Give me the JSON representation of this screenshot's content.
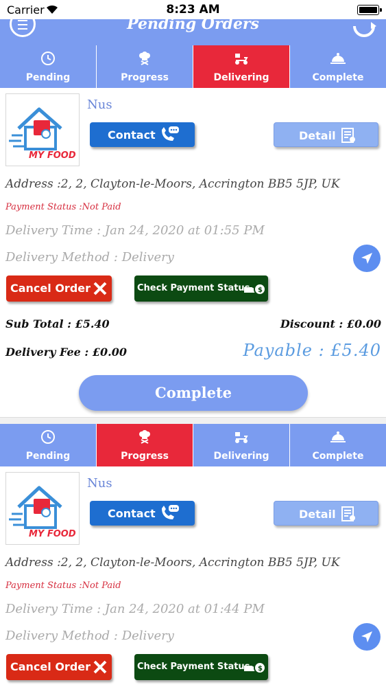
{
  "status_bar": {
    "carrier": "Carrier",
    "time": "8:23 AM"
  },
  "nav": {
    "title": "Pending Orders"
  },
  "tabs": [
    {
      "label": "Pending"
    },
    {
      "label": "Progress"
    },
    {
      "label": "Delivering"
    },
    {
      "label": "Complete"
    }
  ],
  "colors": {
    "accent": "#7b9cf0",
    "active_tab": "#e8283a",
    "contact": "#1e6ed0",
    "cancel": "#d92a16",
    "check_payment": "#0c4a12",
    "payable": "#5a9be0"
  },
  "orders": [
    {
      "active_tab": 2,
      "logo_text": "MY FOOD",
      "customer": "Nus",
      "contact_label": "Contact",
      "detail_label": "Detail",
      "address": "Address :2, 2, Clayton-le-Moors, Accrington BB5 5JP, UK",
      "payment_status": "Payment Status :Not Paid",
      "delivery_time": "Delivery Time : Jan 24, 2020 at 01:55 PM",
      "delivery_method": "Delivery Method : Delivery",
      "cancel_label": "Cancel Order",
      "check_label": "Check Payment Status",
      "subtotal": "Sub Total : £5.40",
      "discount": "Discount : £0.00",
      "delivery_fee": "Delivery Fee : £0.00",
      "payable": "Payable : £5.40",
      "complete_label": "Complete"
    },
    {
      "active_tab": 1,
      "logo_text": "MY FOOD",
      "customer": "Nus",
      "contact_label": "Contact",
      "detail_label": "Detail",
      "address": "Address :2, 2, Clayton-le-Moors, Accrington BB5 5JP, UK",
      "payment_status": "Payment Status :Not Paid",
      "delivery_time": "Delivery Time : Jan 24, 2020 at 01:44 PM",
      "delivery_method": "Delivery Method : Delivery",
      "cancel_label": "Cancel Order",
      "check_label": "Check Payment Status"
    }
  ]
}
